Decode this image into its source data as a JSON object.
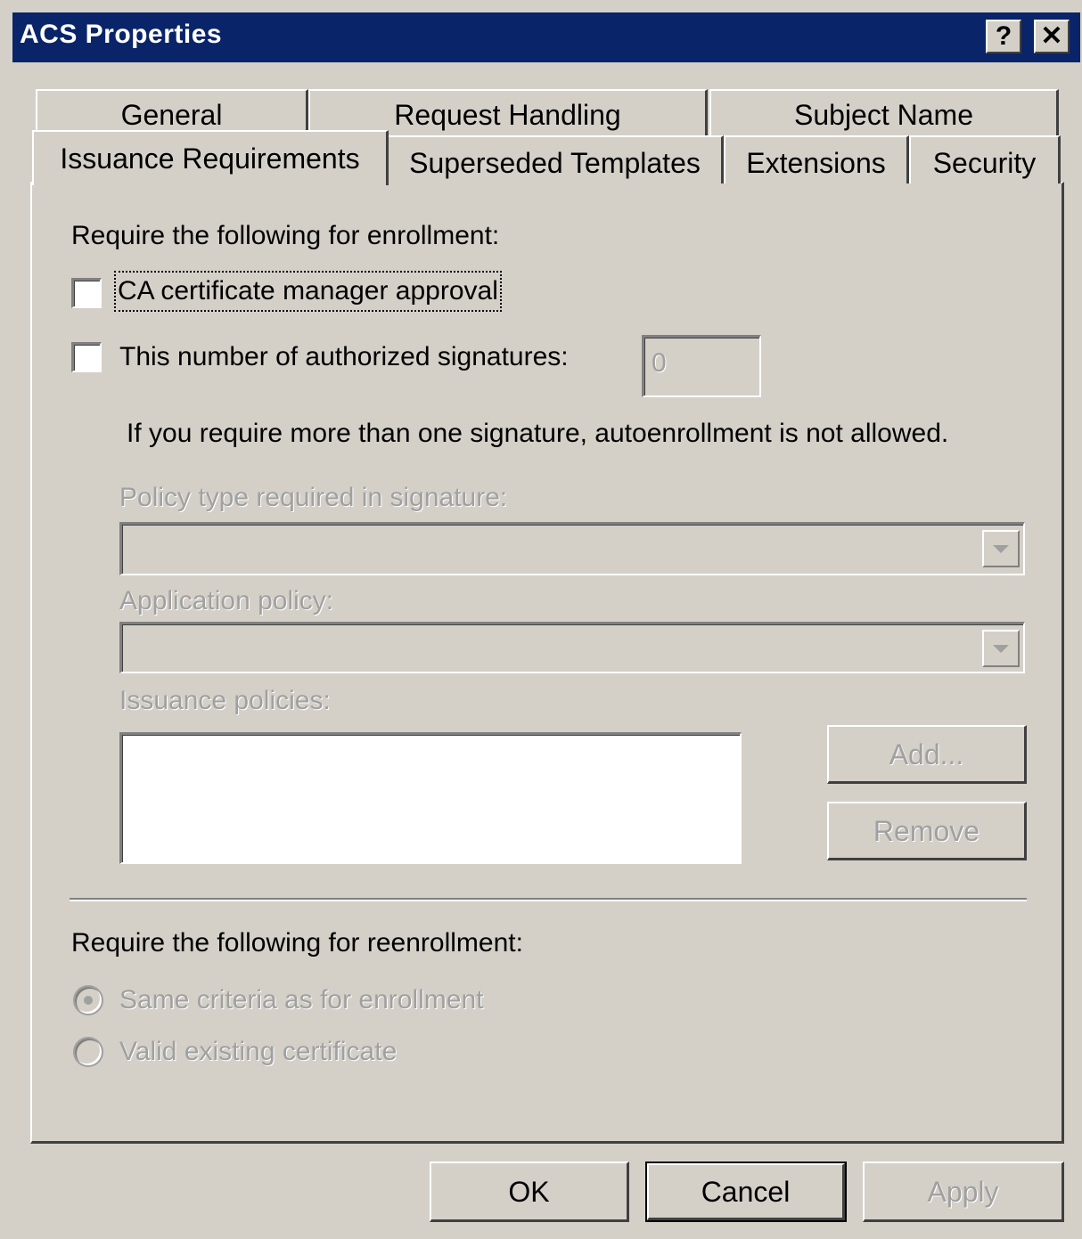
{
  "window": {
    "title": "ACS Properties",
    "help_button": "?",
    "close_button": "✕"
  },
  "tabs": {
    "row1": [
      {
        "label": "General"
      },
      {
        "label": "Request Handling"
      },
      {
        "label": "Subject Name"
      }
    ],
    "row2": [
      {
        "label": "Issuance Requirements",
        "selected": true
      },
      {
        "label": "Superseded Templates"
      },
      {
        "label": "Extensions"
      },
      {
        "label": "Security"
      }
    ]
  },
  "enrollment": {
    "heading": "Require the following for enrollment:",
    "ca_approval_label": "CA certificate manager approval",
    "ca_approval_checked": false,
    "signatures_label": "This number of authorized signatures:",
    "signatures_checked": false,
    "signatures_value": "0",
    "note": "If you require more than one signature, autoenrollment is not allowed.",
    "policy_type_label": "Policy type required in signature:",
    "policy_type_value": "",
    "application_policy_label": "Application policy:",
    "application_policy_value": "",
    "issuance_policies_label": "Issuance policies:",
    "issuance_policies": [],
    "add_button": "Add...",
    "remove_button": "Remove"
  },
  "reenrollment": {
    "heading": "Require the following for reenrollment:",
    "options": [
      {
        "label": "Same criteria as for enrollment",
        "selected": true
      },
      {
        "label": "Valid existing certificate",
        "selected": false
      }
    ]
  },
  "footer": {
    "ok": "OK",
    "cancel": "Cancel",
    "apply": "Apply"
  },
  "colors": {
    "titlebar": "#0a246a",
    "face": "#d4d0c8",
    "disabled_text": "#a0a0a0"
  }
}
